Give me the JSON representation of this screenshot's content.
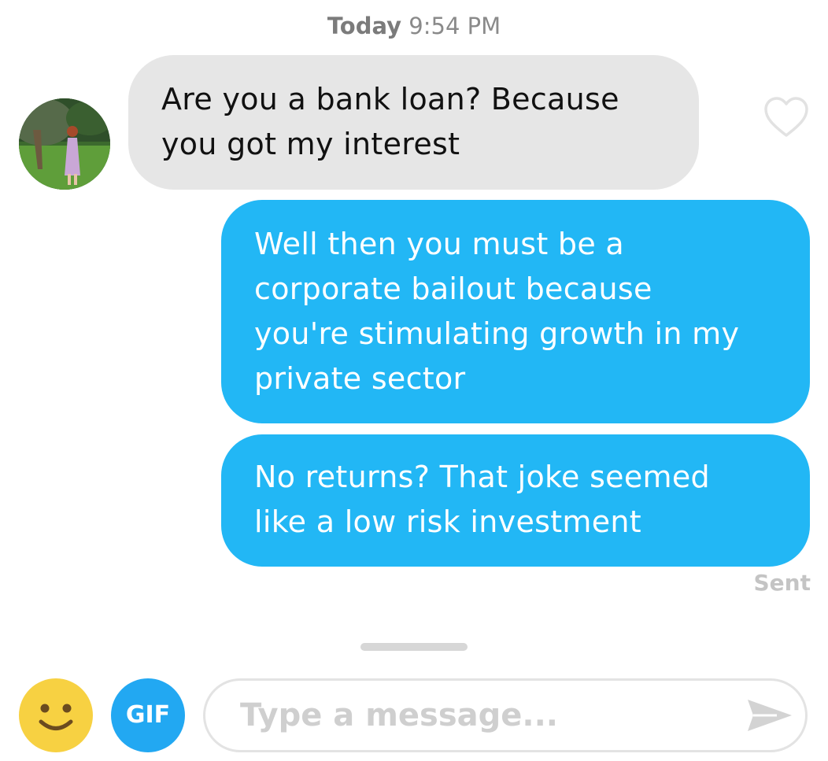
{
  "header": {
    "timestamp_day": "Today",
    "timestamp_time": "9:54 PM"
  },
  "messages": [
    {
      "direction": "incoming",
      "lines": [
        "Are you a bank loan? Because",
        "you got my interest"
      ]
    },
    {
      "direction": "outgoing",
      "lines": [
        "Well then you must be a",
        "corporate bailout because",
        "you're stimulating growth in my",
        "private sector"
      ]
    },
    {
      "direction": "outgoing",
      "lines": [
        "No returns? That joke seemed",
        "like a low risk investment"
      ]
    }
  ],
  "status": {
    "sent_label": "Sent"
  },
  "composer": {
    "gif_label": "GIF",
    "placeholder": "Type a message...",
    "value": ""
  },
  "icons": {
    "like": "heart-outline-icon",
    "emoji": "smiley-face-icon",
    "send": "send-arrow-icon"
  },
  "colors": {
    "incoming_bubble": "#e6e6e6",
    "outgoing_bubble": "#22b7f5",
    "gif_button": "#22a8f2",
    "emoji_button": "#f7d142"
  }
}
